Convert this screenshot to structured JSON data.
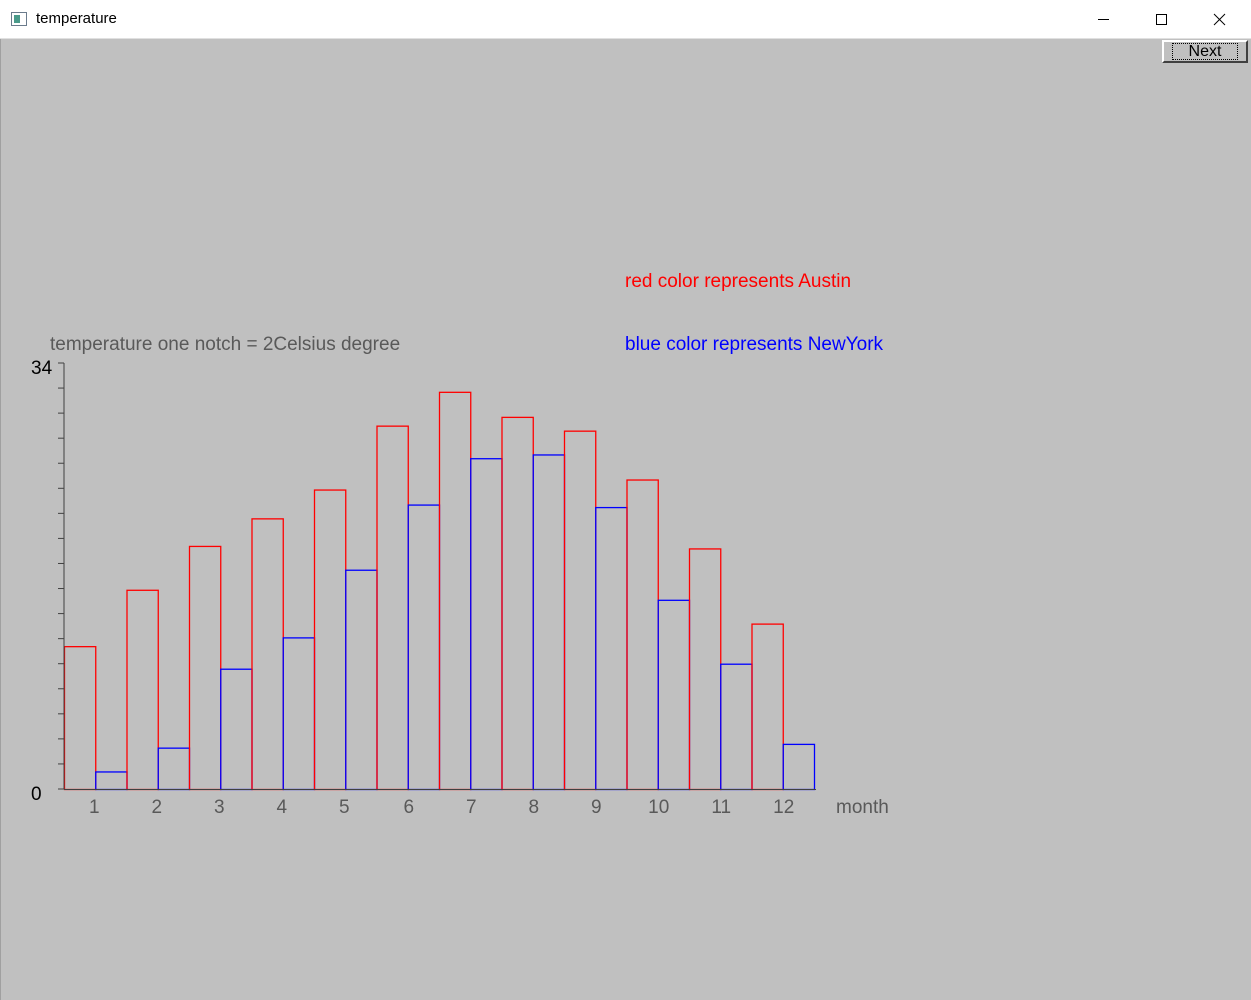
{
  "window": {
    "title": "temperature",
    "icon": "app-window-icon",
    "controls": [
      "minimize-icon",
      "maximize-icon",
      "close-icon"
    ]
  },
  "toolbar": {
    "next_label": "Next"
  },
  "legend": {
    "austin": "red color represents Austin",
    "newyork": "blue color represents NewYork"
  },
  "colors": {
    "background": "#c0c0c0",
    "austin": "#ff0000",
    "newyork": "#0000ff",
    "label": "#595959"
  },
  "chart_data": {
    "type": "bar",
    "ylabel": "temperature  one notch = 2Celsius degree",
    "xlabel": "month",
    "ylim": [
      0,
      34
    ],
    "y_tick_step": 2,
    "y_tick_labels": [
      "0",
      "34"
    ],
    "categories": [
      "1",
      "2",
      "3",
      "4",
      "5",
      "6",
      "7",
      "8",
      "9",
      "10",
      "11",
      "12"
    ],
    "series": [
      {
        "name": "Austin",
        "color": "#ff0000",
        "values": [
          11.4,
          15.9,
          19.4,
          21.6,
          23.9,
          29,
          31.7,
          29.7,
          28.6,
          24.7,
          19.2,
          13.2
        ]
      },
      {
        "name": "NewYork",
        "color": "#0000ff",
        "values": [
          1.4,
          3.3,
          9.6,
          12.1,
          17.5,
          22.7,
          26.4,
          26.7,
          22.5,
          15.1,
          10,
          3.6
        ]
      }
    ]
  }
}
